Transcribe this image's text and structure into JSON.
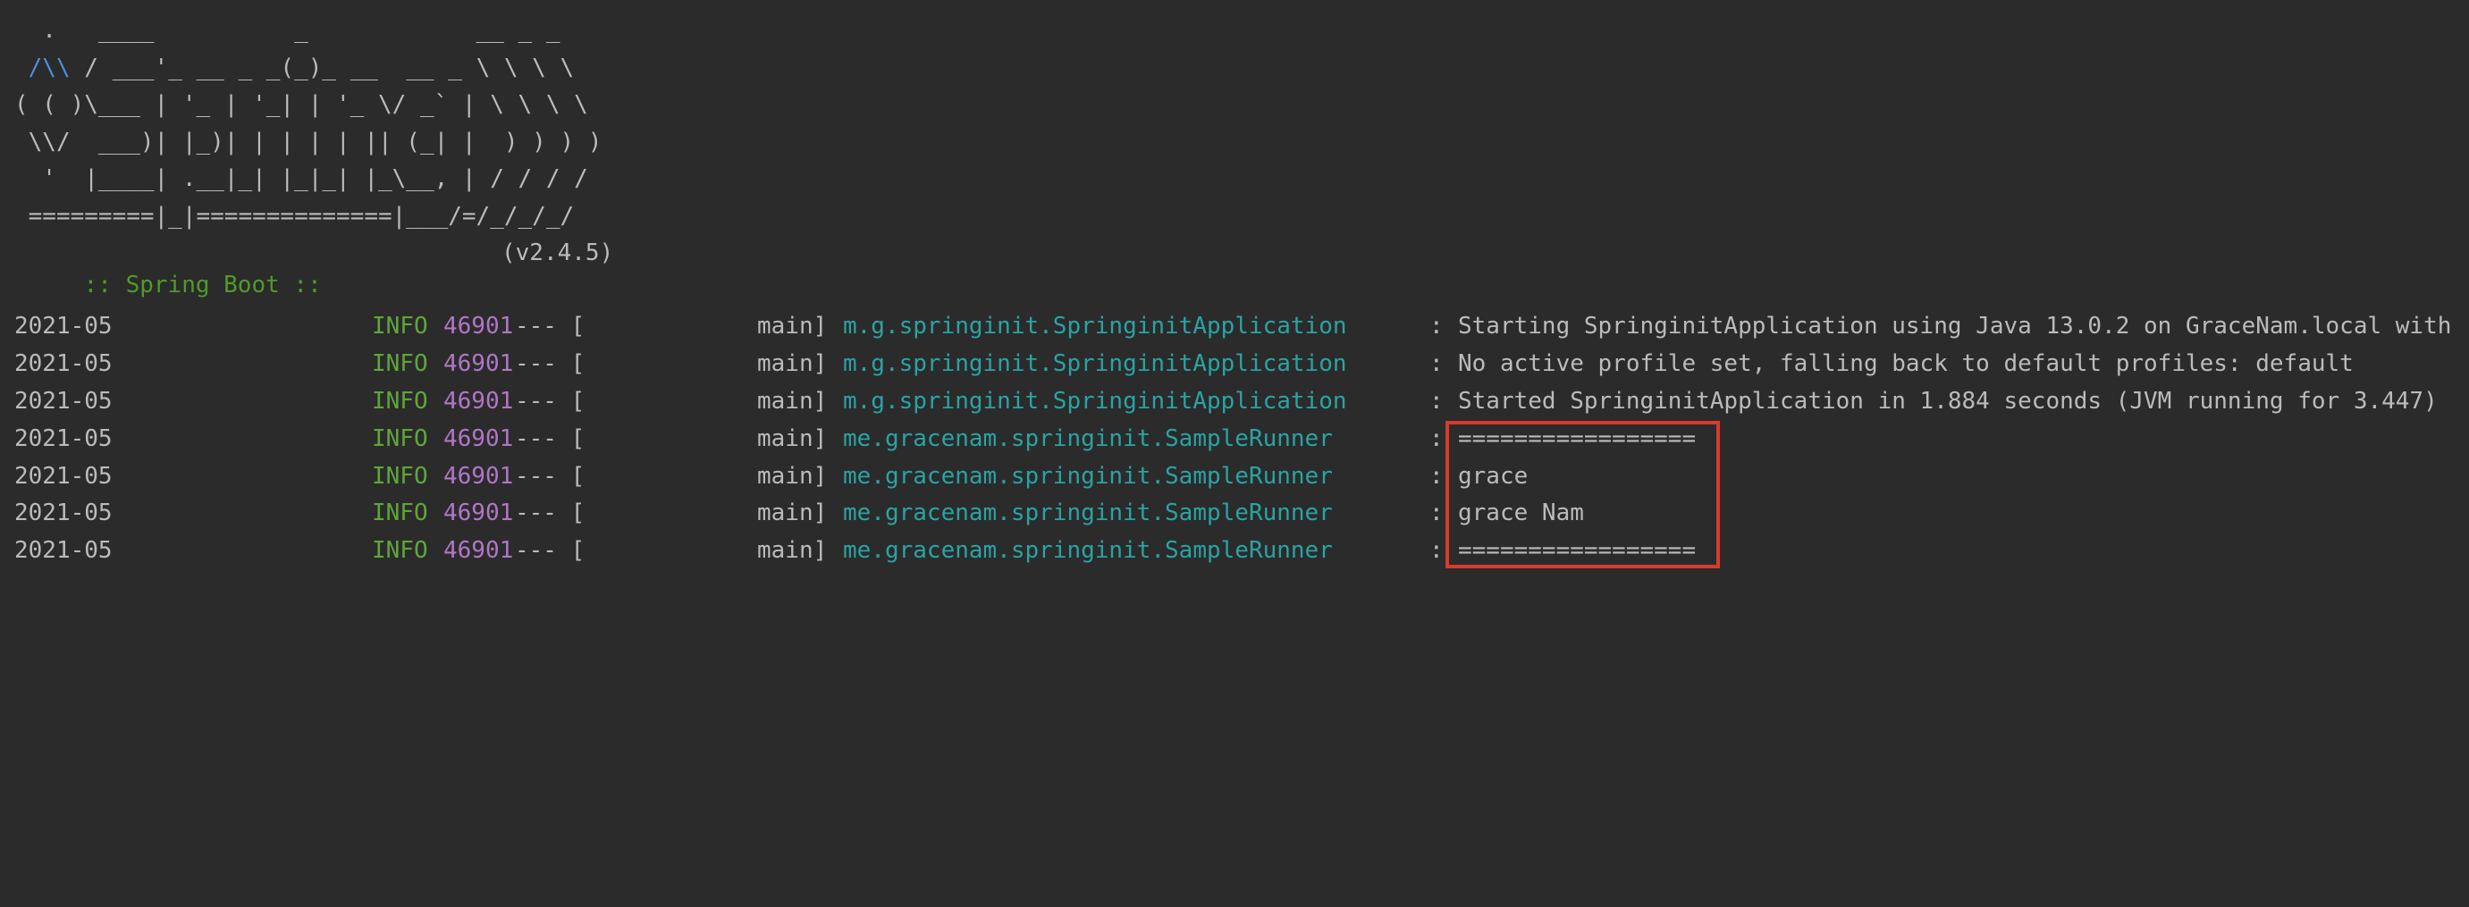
{
  "banner": {
    "line1": "  .   ____          _            __ _ _",
    "line2_blue": " /\\\\",
    "line2_rest": " / ___'_ __ _ _(_)_ __  __ _ \\ \\ \\ \\",
    "line3": "( ( )\\___ | '_ | '_| | '_ \\/ _` | \\ \\ \\ \\",
    "line4": " \\\\/  ___)| |_)| | | | | || (_| |  ) ) ) )",
    "line5": "  '  |____| .__|_| |_|_| |_\\__, | / / / /",
    "line6": " =========|_|==============|___/=/_/_/_/",
    "spring_label": ":: Spring Boot ::",
    "spring_version": "(v2.4.5)"
  },
  "log": [
    {
      "date": "2021-05",
      "level": "INFO",
      "pid": "46901",
      "sep": "--- [",
      "thread": "main]",
      "logger": "m.g.springinit.SpringinitApplication",
      "colon": ":",
      "message": "Starting SpringinitApplication using Java 13.0.2 on GraceNam.local with"
    },
    {
      "date": "2021-05",
      "level": "INFO",
      "pid": "46901",
      "sep": "--- [",
      "thread": "main]",
      "logger": "m.g.springinit.SpringinitApplication",
      "colon": ":",
      "message": "No active profile set, falling back to default profiles: default"
    },
    {
      "date": "2021-05",
      "level": "INFO",
      "pid": "46901",
      "sep": "--- [",
      "thread": "main]",
      "logger": "m.g.springinit.SpringinitApplication",
      "colon": ":",
      "message": "Started SpringinitApplication in 1.884 seconds (JVM running for 3.447)"
    },
    {
      "date": "2021-05",
      "level": "INFO",
      "pid": "46901",
      "sep": "--- [",
      "thread": "main]",
      "logger": "me.gracenam.springinit.SampleRunner",
      "colon": ":",
      "message": "================="
    },
    {
      "date": "2021-05",
      "level": "INFO",
      "pid": "46901",
      "sep": "--- [",
      "thread": "main]",
      "logger": "me.gracenam.springinit.SampleRunner",
      "colon": ":",
      "message": "grace"
    },
    {
      "date": "2021-05",
      "level": "INFO",
      "pid": "46901",
      "sep": "--- [",
      "thread": "main]",
      "logger": "me.gracenam.springinit.SampleRunner",
      "colon": ":",
      "message": "grace Nam"
    },
    {
      "date": "2021-05",
      "level": "INFO",
      "pid": "46901",
      "sep": "--- [",
      "thread": "main]",
      "logger": "me.gracenam.springinit.SampleRunner",
      "colon": ":",
      "message": "================="
    }
  ],
  "colors": {
    "background": "#2b2b2b",
    "text": "#bbbbbb",
    "info_level": "#5fa63a",
    "pid": "#b176c7",
    "logger": "#2aa3a3",
    "banner_accent": "#4a90d9",
    "spring_label": "#4f9a2a",
    "highlight_border": "#d93a2b"
  }
}
